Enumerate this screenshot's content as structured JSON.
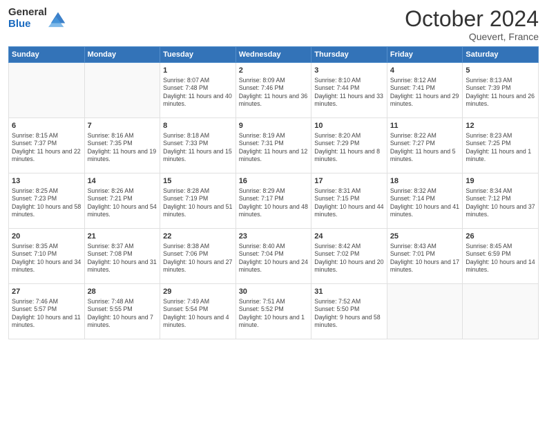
{
  "header": {
    "logo_general": "General",
    "logo_blue": "Blue",
    "month_title": "October 2024",
    "subtitle": "Quevert, France"
  },
  "weekdays": [
    "Sunday",
    "Monday",
    "Tuesday",
    "Wednesday",
    "Thursday",
    "Friday",
    "Saturday"
  ],
  "weeks": [
    [
      {
        "day": "",
        "sunrise": "",
        "sunset": "",
        "daylight": ""
      },
      {
        "day": "",
        "sunrise": "",
        "sunset": "",
        "daylight": ""
      },
      {
        "day": "1",
        "sunrise": "Sunrise: 8:07 AM",
        "sunset": "Sunset: 7:48 PM",
        "daylight": "Daylight: 11 hours and 40 minutes."
      },
      {
        "day": "2",
        "sunrise": "Sunrise: 8:09 AM",
        "sunset": "Sunset: 7:46 PM",
        "daylight": "Daylight: 11 hours and 36 minutes."
      },
      {
        "day": "3",
        "sunrise": "Sunrise: 8:10 AM",
        "sunset": "Sunset: 7:44 PM",
        "daylight": "Daylight: 11 hours and 33 minutes."
      },
      {
        "day": "4",
        "sunrise": "Sunrise: 8:12 AM",
        "sunset": "Sunset: 7:41 PM",
        "daylight": "Daylight: 11 hours and 29 minutes."
      },
      {
        "day": "5",
        "sunrise": "Sunrise: 8:13 AM",
        "sunset": "Sunset: 7:39 PM",
        "daylight": "Daylight: 11 hours and 26 minutes."
      }
    ],
    [
      {
        "day": "6",
        "sunrise": "Sunrise: 8:15 AM",
        "sunset": "Sunset: 7:37 PM",
        "daylight": "Daylight: 11 hours and 22 minutes."
      },
      {
        "day": "7",
        "sunrise": "Sunrise: 8:16 AM",
        "sunset": "Sunset: 7:35 PM",
        "daylight": "Daylight: 11 hours and 19 minutes."
      },
      {
        "day": "8",
        "sunrise": "Sunrise: 8:18 AM",
        "sunset": "Sunset: 7:33 PM",
        "daylight": "Daylight: 11 hours and 15 minutes."
      },
      {
        "day": "9",
        "sunrise": "Sunrise: 8:19 AM",
        "sunset": "Sunset: 7:31 PM",
        "daylight": "Daylight: 11 hours and 12 minutes."
      },
      {
        "day": "10",
        "sunrise": "Sunrise: 8:20 AM",
        "sunset": "Sunset: 7:29 PM",
        "daylight": "Daylight: 11 hours and 8 minutes."
      },
      {
        "day": "11",
        "sunrise": "Sunrise: 8:22 AM",
        "sunset": "Sunset: 7:27 PM",
        "daylight": "Daylight: 11 hours and 5 minutes."
      },
      {
        "day": "12",
        "sunrise": "Sunrise: 8:23 AM",
        "sunset": "Sunset: 7:25 PM",
        "daylight": "Daylight: 11 hours and 1 minute."
      }
    ],
    [
      {
        "day": "13",
        "sunrise": "Sunrise: 8:25 AM",
        "sunset": "Sunset: 7:23 PM",
        "daylight": "Daylight: 10 hours and 58 minutes."
      },
      {
        "day": "14",
        "sunrise": "Sunrise: 8:26 AM",
        "sunset": "Sunset: 7:21 PM",
        "daylight": "Daylight: 10 hours and 54 minutes."
      },
      {
        "day": "15",
        "sunrise": "Sunrise: 8:28 AM",
        "sunset": "Sunset: 7:19 PM",
        "daylight": "Daylight: 10 hours and 51 minutes."
      },
      {
        "day": "16",
        "sunrise": "Sunrise: 8:29 AM",
        "sunset": "Sunset: 7:17 PM",
        "daylight": "Daylight: 10 hours and 48 minutes."
      },
      {
        "day": "17",
        "sunrise": "Sunrise: 8:31 AM",
        "sunset": "Sunset: 7:15 PM",
        "daylight": "Daylight: 10 hours and 44 minutes."
      },
      {
        "day": "18",
        "sunrise": "Sunrise: 8:32 AM",
        "sunset": "Sunset: 7:14 PM",
        "daylight": "Daylight: 10 hours and 41 minutes."
      },
      {
        "day": "19",
        "sunrise": "Sunrise: 8:34 AM",
        "sunset": "Sunset: 7:12 PM",
        "daylight": "Daylight: 10 hours and 37 minutes."
      }
    ],
    [
      {
        "day": "20",
        "sunrise": "Sunrise: 8:35 AM",
        "sunset": "Sunset: 7:10 PM",
        "daylight": "Daylight: 10 hours and 34 minutes."
      },
      {
        "day": "21",
        "sunrise": "Sunrise: 8:37 AM",
        "sunset": "Sunset: 7:08 PM",
        "daylight": "Daylight: 10 hours and 31 minutes."
      },
      {
        "day": "22",
        "sunrise": "Sunrise: 8:38 AM",
        "sunset": "Sunset: 7:06 PM",
        "daylight": "Daylight: 10 hours and 27 minutes."
      },
      {
        "day": "23",
        "sunrise": "Sunrise: 8:40 AM",
        "sunset": "Sunset: 7:04 PM",
        "daylight": "Daylight: 10 hours and 24 minutes."
      },
      {
        "day": "24",
        "sunrise": "Sunrise: 8:42 AM",
        "sunset": "Sunset: 7:02 PM",
        "daylight": "Daylight: 10 hours and 20 minutes."
      },
      {
        "day": "25",
        "sunrise": "Sunrise: 8:43 AM",
        "sunset": "Sunset: 7:01 PM",
        "daylight": "Daylight: 10 hours and 17 minutes."
      },
      {
        "day": "26",
        "sunrise": "Sunrise: 8:45 AM",
        "sunset": "Sunset: 6:59 PM",
        "daylight": "Daylight: 10 hours and 14 minutes."
      }
    ],
    [
      {
        "day": "27",
        "sunrise": "Sunrise: 7:46 AM",
        "sunset": "Sunset: 5:57 PM",
        "daylight": "Daylight: 10 hours and 11 minutes."
      },
      {
        "day": "28",
        "sunrise": "Sunrise: 7:48 AM",
        "sunset": "Sunset: 5:55 PM",
        "daylight": "Daylight: 10 hours and 7 minutes."
      },
      {
        "day": "29",
        "sunrise": "Sunrise: 7:49 AM",
        "sunset": "Sunset: 5:54 PM",
        "daylight": "Daylight: 10 hours and 4 minutes."
      },
      {
        "day": "30",
        "sunrise": "Sunrise: 7:51 AM",
        "sunset": "Sunset: 5:52 PM",
        "daylight": "Daylight: 10 hours and 1 minute."
      },
      {
        "day": "31",
        "sunrise": "Sunrise: 7:52 AM",
        "sunset": "Sunset: 5:50 PM",
        "daylight": "Daylight: 9 hours and 58 minutes."
      },
      {
        "day": "",
        "sunrise": "",
        "sunset": "",
        "daylight": ""
      },
      {
        "day": "",
        "sunrise": "",
        "sunset": "",
        "daylight": ""
      }
    ]
  ]
}
